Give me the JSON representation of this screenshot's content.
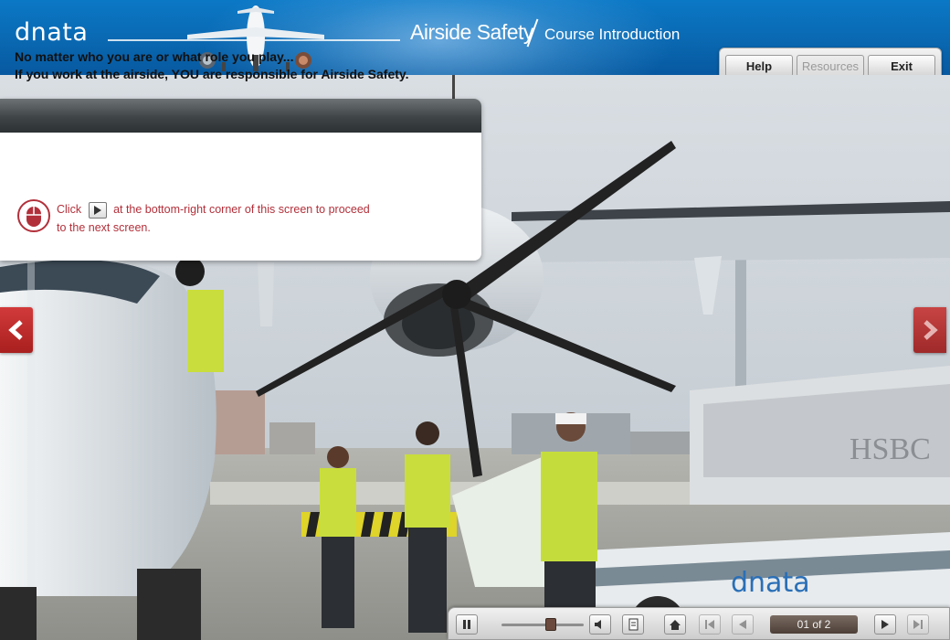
{
  "header": {
    "logo": "dnata",
    "title": "Airside Safety",
    "subtitle": "Course Introduction"
  },
  "toolbar": {
    "help": "Help",
    "resources": "Resources",
    "exit": "Exit"
  },
  "card": {
    "line1": "No matter who you are or what role you play...",
    "line2": "If you work at the airside, YOU are responsible for Airside Safety.",
    "instruction_before": "Click",
    "instruction_after": "at the bottom-right corner of this screen to proceed",
    "instruction_line2": "to the next screen."
  },
  "scene": {
    "truck_logo": "dnata",
    "hsbc_text": "HSBC"
  },
  "player": {
    "page_indicator": "01 of 2",
    "seek_progress": 0.6
  },
  "colors": {
    "header_blue": "#0a6bb5",
    "accent_red": "#b2303a",
    "arrow_red": "#c62f2f"
  },
  "icons": {
    "mouse": "mouse-icon",
    "pause": "pause-icon",
    "volume": "volume-icon",
    "transcript": "transcript-icon",
    "home": "home-icon",
    "first": "first-page-icon",
    "prev": "previous-icon",
    "next": "next-icon",
    "last": "last-page-icon"
  }
}
